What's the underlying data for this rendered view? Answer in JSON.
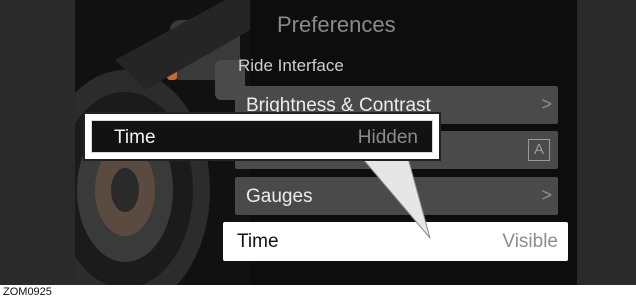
{
  "screen": {
    "title": "Preferences",
    "section": "Ride Interface"
  },
  "menu": {
    "brightness": {
      "label": "Brightness & Contrast",
      "chevron": ">"
    },
    "auto_mode": {
      "icon_letter": "A"
    },
    "gauges": {
      "label": "Gauges",
      "chevron": ">"
    },
    "time": {
      "label": "Time",
      "value": "Visible"
    }
  },
  "callout": {
    "label": "Time",
    "value": "Hidden"
  },
  "reference_code": "ZOM0925",
  "colors": {
    "screen_bg": "#0d0d0d",
    "row_bg": "#4a4a4a",
    "highlight_bg": "#ffffff",
    "muted_text": "#8c8c8c"
  }
}
